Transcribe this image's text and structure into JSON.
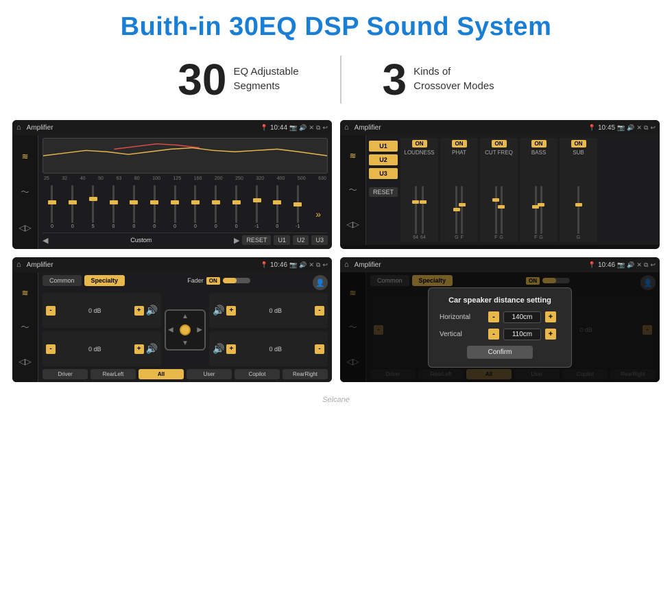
{
  "header": {
    "title": "Buith-in 30EQ DSP Sound System"
  },
  "stats": [
    {
      "number": "30",
      "text_line1": "EQ Adjustable",
      "text_line2": "Segments"
    },
    {
      "number": "3",
      "text_line1": "Kinds of",
      "text_line2": "Crossover Modes"
    }
  ],
  "screens": [
    {
      "id": "screen1",
      "topbar": {
        "title": "Amplifier",
        "time": "10:44"
      },
      "eq_labels": [
        "25",
        "32",
        "40",
        "50",
        "63",
        "80",
        "100",
        "125",
        "160",
        "200",
        "250",
        "320",
        "400",
        "500",
        "630"
      ],
      "bottom_buttons": [
        "Custom",
        "RESET",
        "U1",
        "U2",
        "U3"
      ]
    },
    {
      "id": "screen2",
      "topbar": {
        "title": "Amplifier",
        "time": "10:45"
      },
      "u_buttons": [
        "U1",
        "U2",
        "U3"
      ],
      "bands": [
        {
          "label": "LOUDNESS",
          "on": true
        },
        {
          "label": "PHAT",
          "on": true
        },
        {
          "label": "CUT FREQ",
          "on": true
        },
        {
          "label": "BASS",
          "on": true
        },
        {
          "label": "SUB",
          "on": true
        }
      ],
      "reset_label": "RESET"
    },
    {
      "id": "screen3",
      "topbar": {
        "title": "Amplifier",
        "time": "10:46"
      },
      "tabs": [
        "Common",
        "Specialty"
      ],
      "fader_label": "Fader",
      "fader_on": "ON",
      "channels": [
        {
          "position": "top-left",
          "db": "0 dB"
        },
        {
          "position": "top-right",
          "db": "0 dB"
        },
        {
          "position": "bottom-left",
          "db": "0 dB"
        },
        {
          "position": "bottom-right",
          "db": "0 dB"
        }
      ],
      "bottom_buttons": [
        "Driver",
        "All",
        "User",
        "Copilot",
        "RearLeft",
        "RearRight"
      ]
    },
    {
      "id": "screen4",
      "topbar": {
        "title": "Amplifier",
        "time": "10:46"
      },
      "tabs": [
        "Common",
        "Specialty"
      ],
      "dialog": {
        "title": "Car speaker distance setting",
        "horizontal_label": "Horizontal",
        "horizontal_value": "140cm",
        "vertical_label": "Vertical",
        "vertical_value": "110cm",
        "confirm_label": "Confirm"
      },
      "bottom_buttons": [
        "Driver",
        "All",
        "User",
        "Copilot",
        "RearLeft",
        "RearRight"
      ]
    }
  ],
  "watermark": "Seicane"
}
